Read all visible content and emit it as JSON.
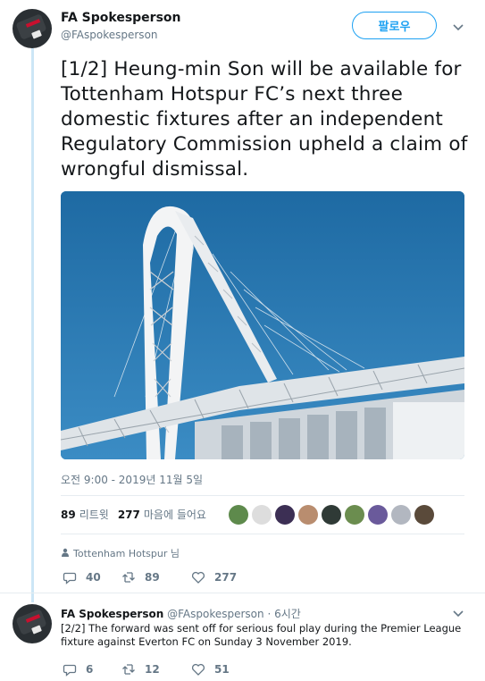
{
  "colors": {
    "accent": "#1da1f2",
    "muted": "#657786",
    "text": "#14171a",
    "thread": "#cce6f6"
  },
  "tweet": {
    "author_name": "FA Spokesperson",
    "author_handle": "@FAspokesperson",
    "follow_label": "팔로우",
    "text": "[1/2] Heung-min Son will be available for Tottenham Hotspur FC’s next three domestic fixtures after an independent Regulatory Commission upheld a claim of wrongful dismissal.",
    "timestamp": "오전 9:00 - 2019년 11월 5일",
    "retweet_count": "89",
    "retweet_label": "리트윗",
    "like_count": "277",
    "like_label": "마음에 들어요",
    "liker_colors": [
      "#5e8a4c",
      "#dddddd",
      "#3c2f54",
      "#b98d6f",
      "#2f3a36",
      "#6b8d4f",
      "#6a5a9b",
      "#b2b7c0",
      "#5a4a3a"
    ],
    "mentioned_team": "Tottenham Hotspur 님",
    "actions": {
      "replies": "40",
      "retweets": "89",
      "likes": "277"
    }
  },
  "reply": {
    "author_name": "FA Spokesperson",
    "author_handle": "@FAspokesperson",
    "time": "· 6시간",
    "text": "[2/2] The forward was sent off for serious foul play during the Premier League fixture against Everton FC on Sunday 3 November 2019.",
    "actions": {
      "replies": "6",
      "retweets": "12",
      "likes": "51"
    }
  }
}
